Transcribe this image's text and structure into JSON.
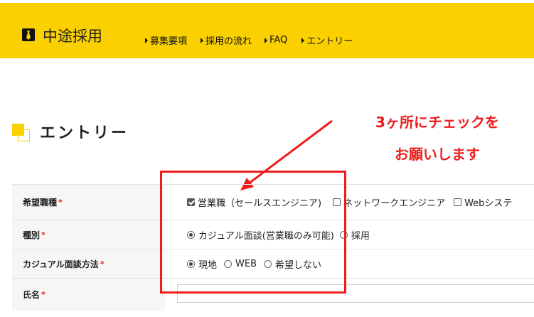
{
  "header": {
    "logo_text": "中途採用",
    "logo_icon": "necktie-icon",
    "nav": [
      {
        "label": "募集要項"
      },
      {
        "label": "採用の流れ"
      },
      {
        "label": "FAQ"
      },
      {
        "label": "エントリー"
      }
    ],
    "bg_color": "#fad000"
  },
  "section": {
    "title": "エントリー"
  },
  "annotation": {
    "line1": "3ヶ所にチェックを",
    "line2": "お願いします",
    "color": "#ee1c1c"
  },
  "form": {
    "rows": [
      {
        "label": "希望職種",
        "required": "*",
        "options": [
          {
            "label": "営業職（セールスエンジニア)",
            "checked": true
          },
          {
            "label": "ネットワークエンジニア",
            "checked": false
          },
          {
            "label": "Webシステ",
            "checked": false
          }
        ]
      },
      {
        "label": "種別",
        "required": "*",
        "options": [
          {
            "label": "カジュアル面談(営業職のみ可能)",
            "checked": true
          },
          {
            "label": "採用",
            "checked": false
          }
        ]
      },
      {
        "label": "カジュアル面談方法",
        "required": "*",
        "options": [
          {
            "label": "現地",
            "checked": true
          },
          {
            "label": "WEB",
            "checked": false
          },
          {
            "label": "希望しない",
            "checked": false
          }
        ]
      },
      {
        "label": "氏名",
        "required": "*",
        "value": ""
      }
    ]
  }
}
